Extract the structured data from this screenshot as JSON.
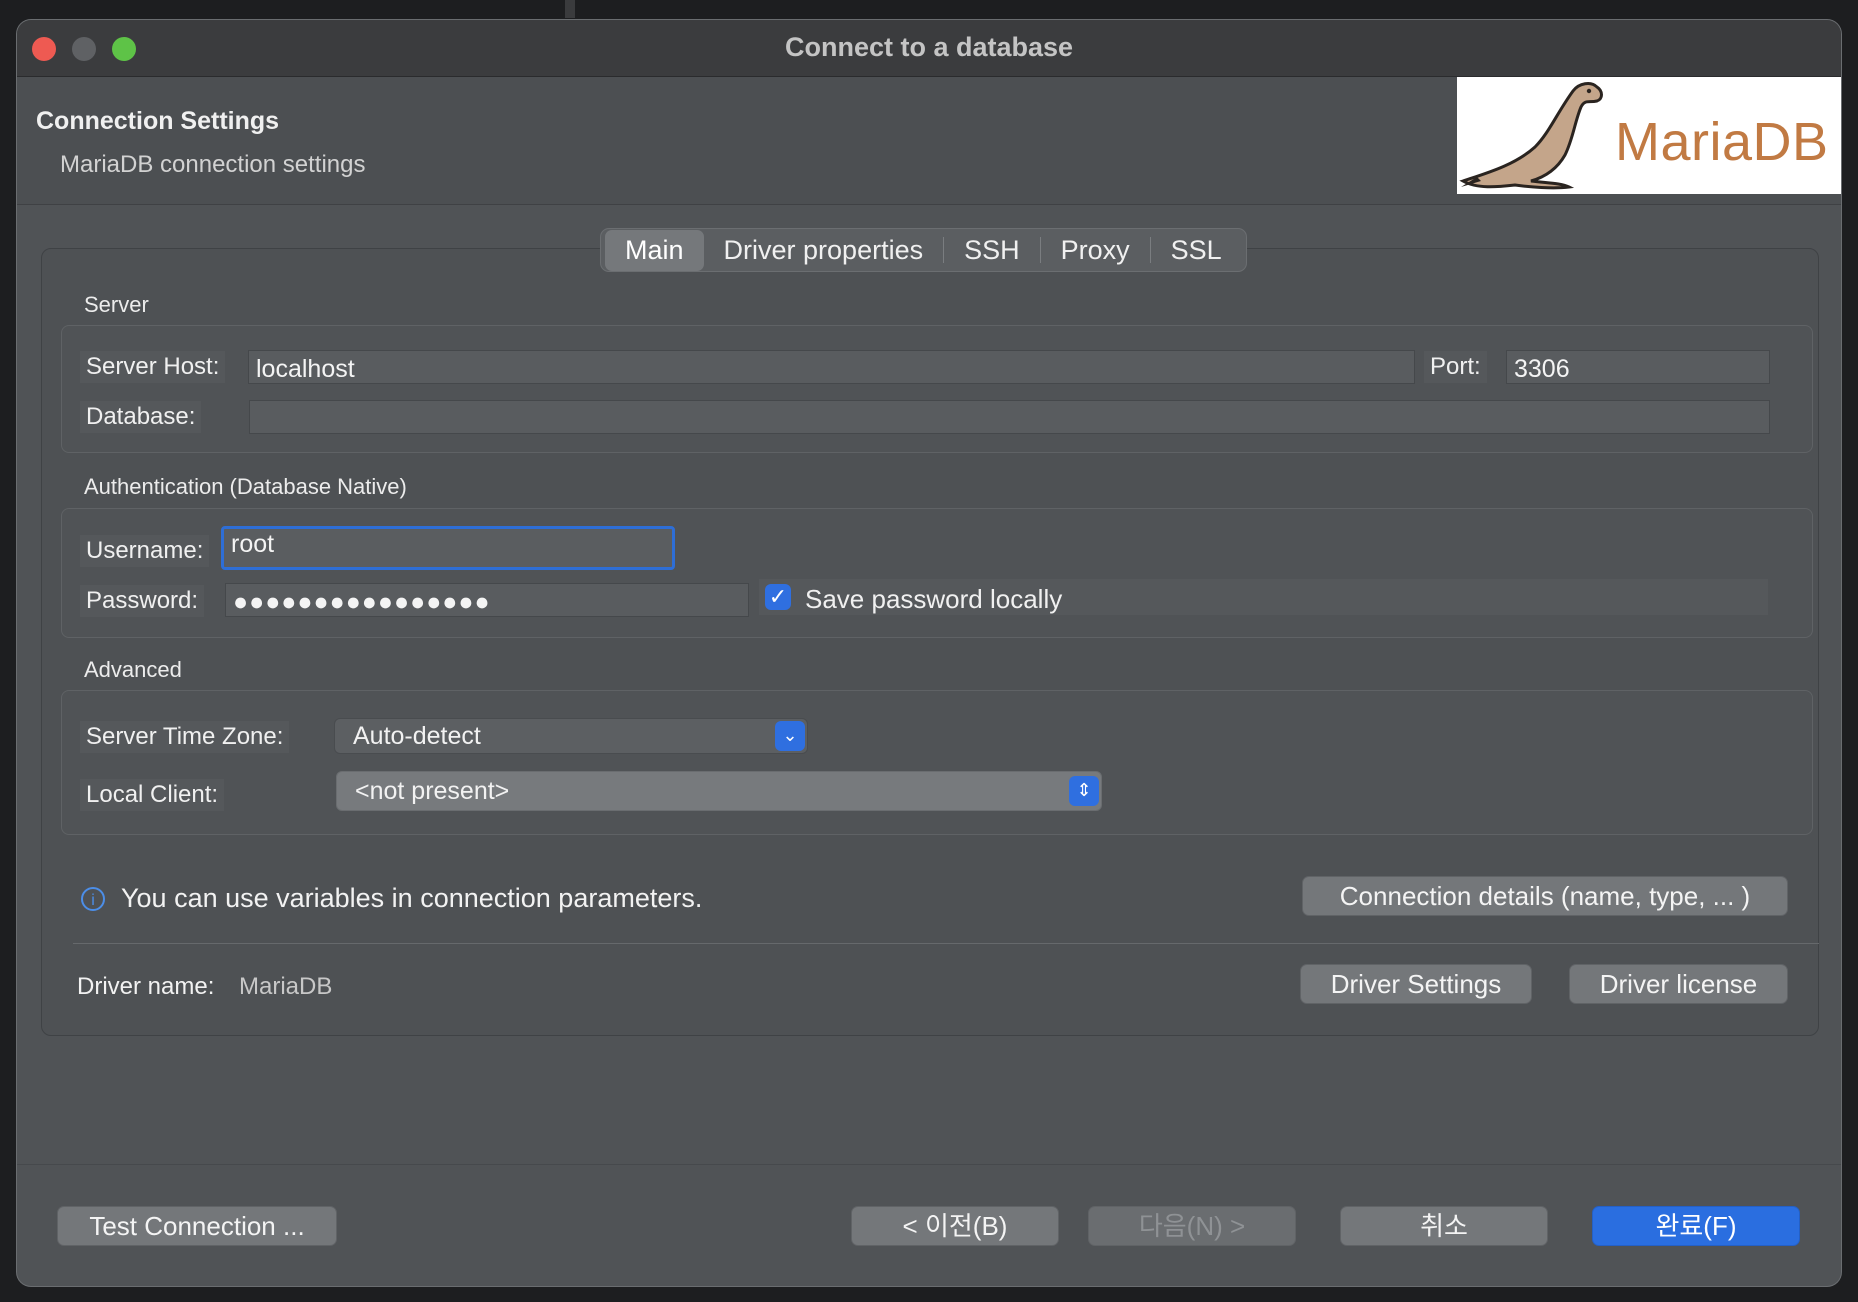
{
  "window": {
    "title": "Connect to a database"
  },
  "header": {
    "title": "Connection Settings",
    "subtitle": "MariaDB connection settings",
    "logo_text": "MariaDB"
  },
  "tabs": [
    {
      "label": "Main",
      "active": true
    },
    {
      "label": "Driver properties",
      "active": false
    },
    {
      "label": "SSH",
      "active": false
    },
    {
      "label": "Proxy",
      "active": false
    },
    {
      "label": "SSL",
      "active": false
    }
  ],
  "server": {
    "section_label": "Server",
    "host_label": "Server Host:",
    "host_value": "localhost",
    "port_label": "Port:",
    "port_value": "3306",
    "database_label": "Database:",
    "database_value": ""
  },
  "auth": {
    "section_label": "Authentication (Database Native)",
    "username_label": "Username:",
    "username_value": "root",
    "password_label": "Password:",
    "password_value": "●●●●●●●●●●●●●●●●",
    "save_password_label": "Save password locally",
    "save_password_checked": true
  },
  "advanced": {
    "section_label": "Advanced",
    "timezone_label": "Server Time Zone:",
    "timezone_value": "Auto-detect",
    "local_client_label": "Local Client:",
    "local_client_value": "<not present>"
  },
  "info": {
    "text": "You can use variables in connection parameters.",
    "connection_details_button": "Connection details (name, type, ... )"
  },
  "driver": {
    "name_label": "Driver name:",
    "name_value": "MariaDB",
    "settings_button": "Driver Settings",
    "license_button": "Driver license"
  },
  "footer": {
    "test_button": "Test Connection ...",
    "back_button": "< 이전(B)",
    "next_button": "다음(N) >",
    "cancel_button": "취소",
    "finish_button": "완료(F)"
  },
  "colors": {
    "accent": "#2f6fe0",
    "logo_brand": "#c17a43",
    "window_bg": "#505356"
  }
}
